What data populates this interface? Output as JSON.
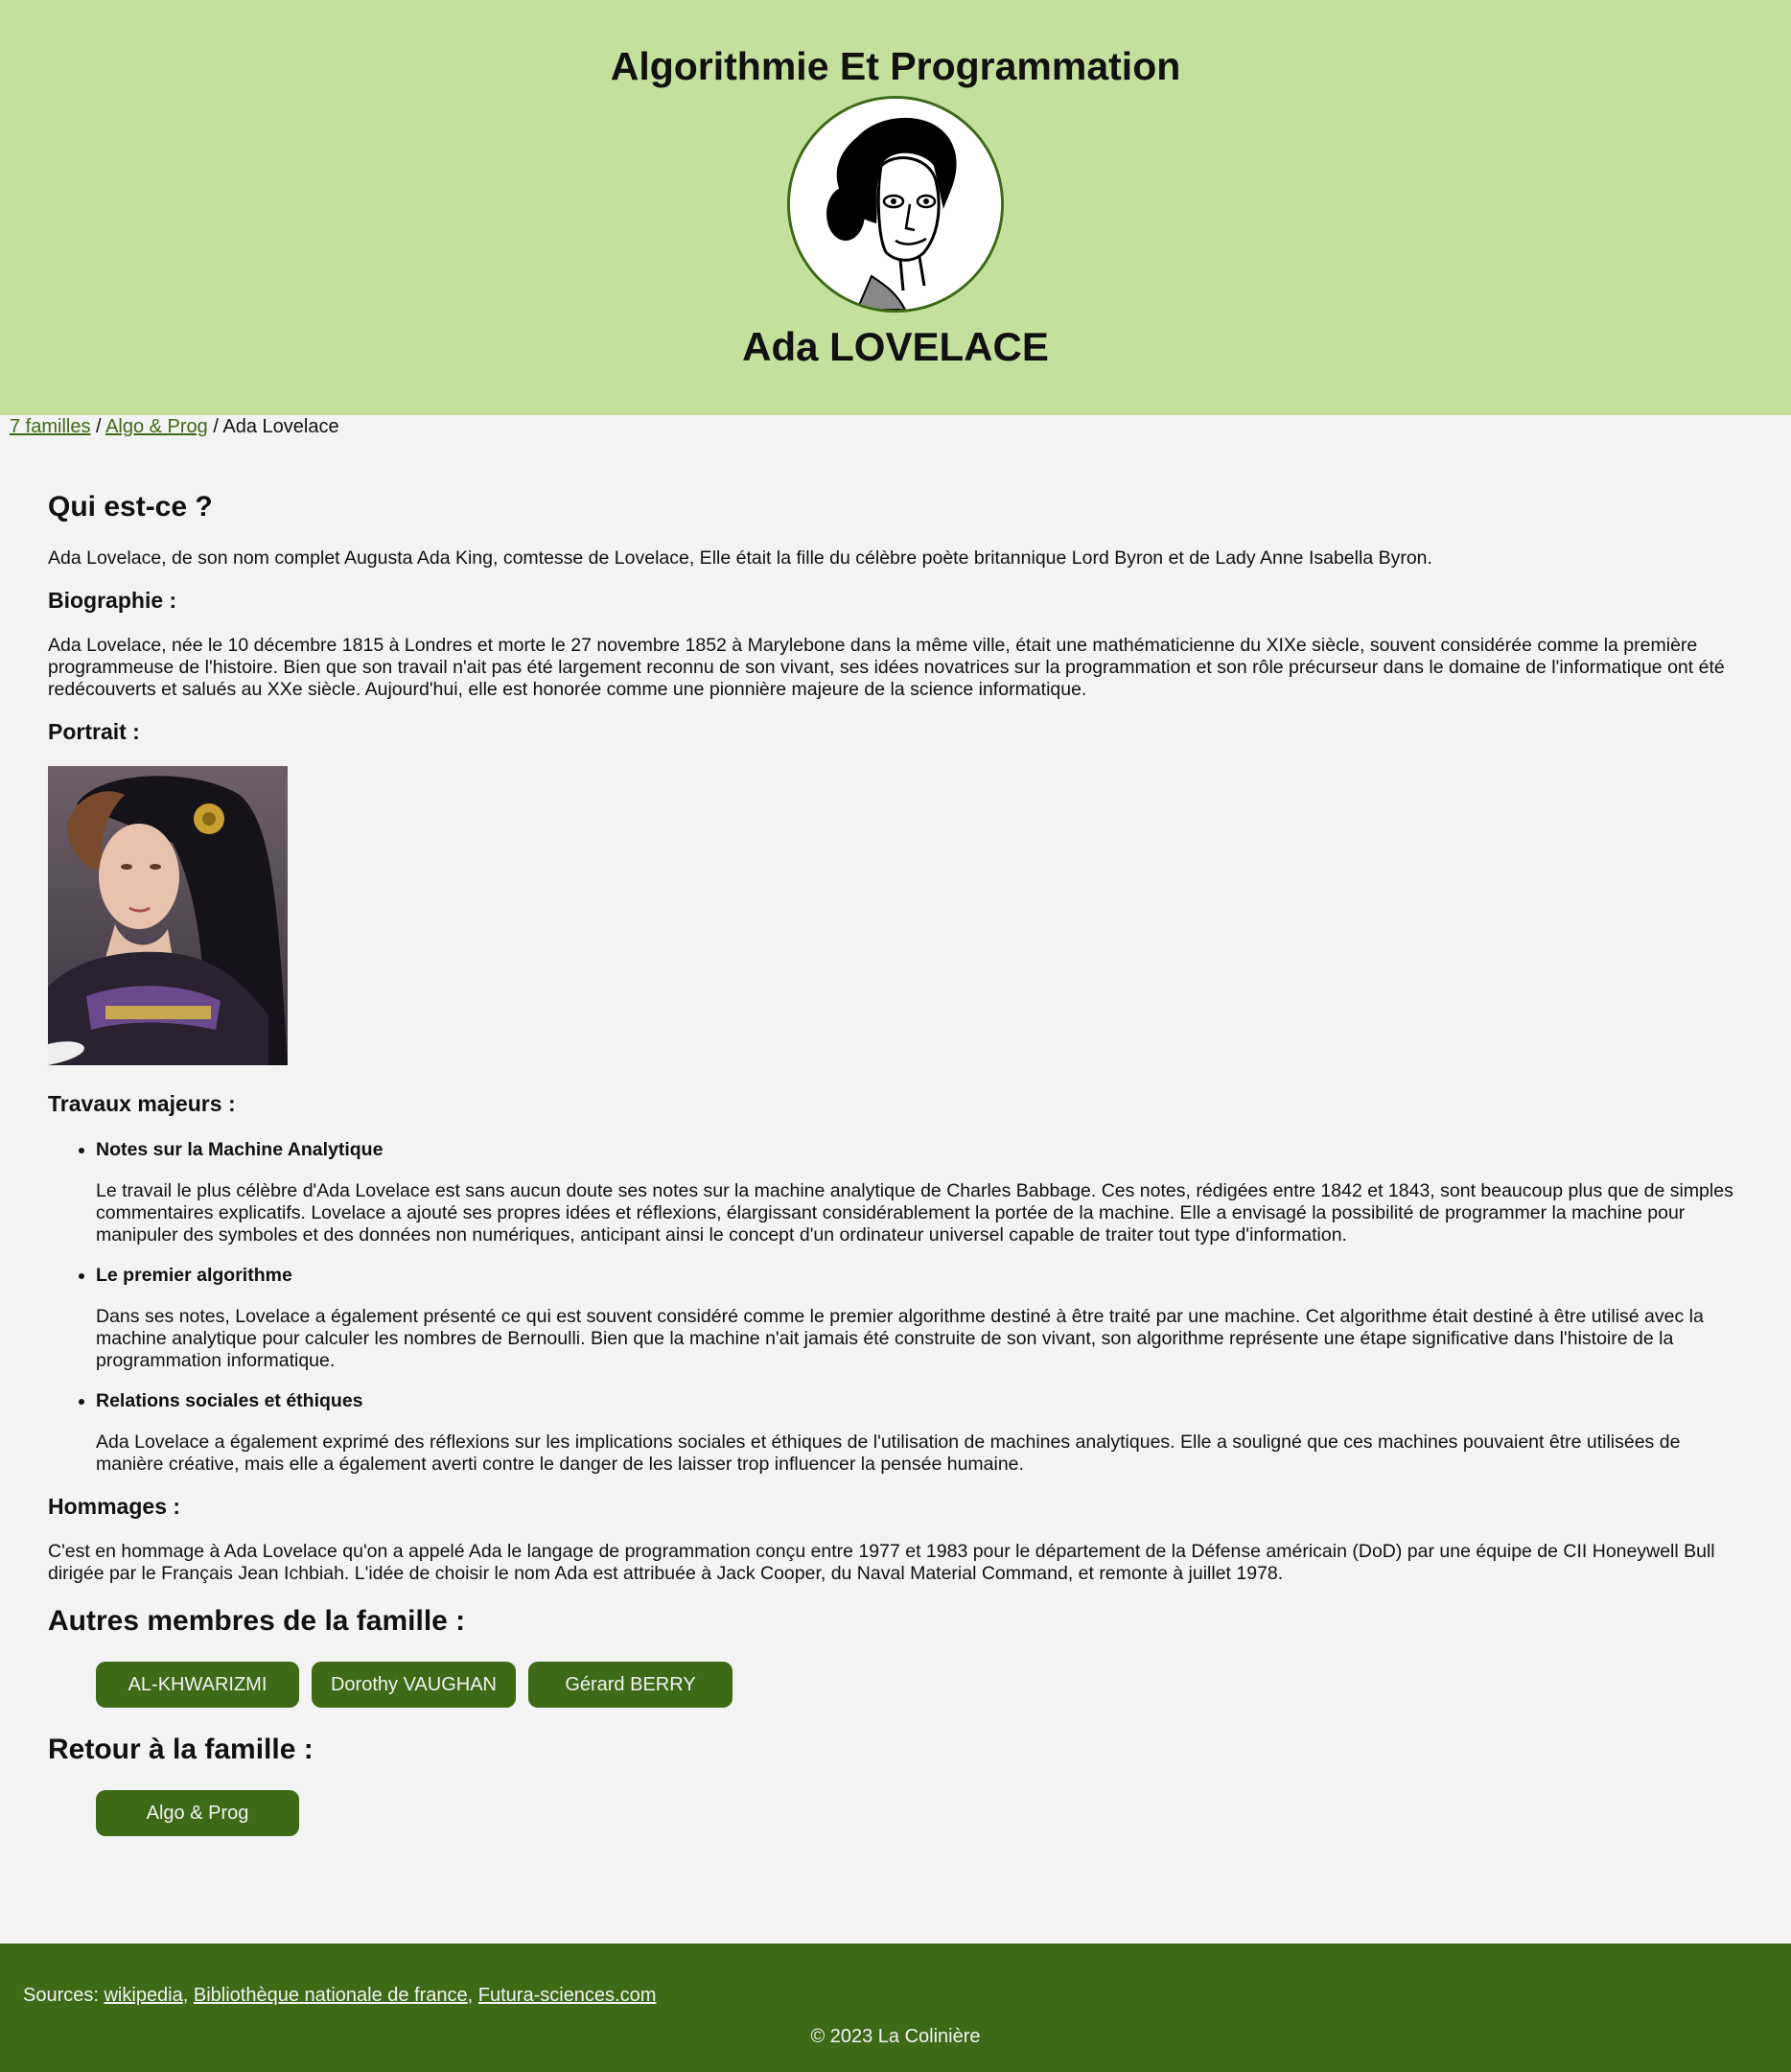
{
  "header": {
    "site_title": "Algorithmie Et Programmation",
    "person_name": "Ada LOVELACE"
  },
  "breadcrumb": {
    "link1": "7 familles",
    "sep1": " / ",
    "link2": "Algo & Prog",
    "sep2": " / ",
    "current": "Ada Lovelace"
  },
  "content": {
    "who_title": "Qui est-ce ?",
    "who_text": "Ada Lovelace, de son nom complet Augusta Ada King, comtesse de Lovelace, Elle était la fille du célèbre poète britannique Lord Byron et de Lady Anne Isabella Byron.",
    "bio_title": "Biographie :",
    "bio_text": "Ada Lovelace, née le 10 décembre 1815 à Londres et morte le 27 novembre 1852 à Marylebone dans la même ville, était une mathématicienne du XIXe siècle, souvent considérée comme la première programmeuse de l'histoire. Bien que son travail n'ait pas été largement reconnu de son vivant, ses idées novatrices sur la programmation et son rôle précurseur dans le domaine de l'informatique ont été redécouverts et salués au XXe siècle. Aujourd'hui, elle est honorée comme une pionnière majeure de la science informatique.",
    "portrait_title": "Portrait :",
    "works_title": "Travaux majeurs :",
    "works": [
      {
        "title": "Notes sur la Machine Analytique",
        "text": "Le travail le plus célèbre d'Ada Lovelace est sans aucun doute ses notes sur la machine analytique de Charles Babbage. Ces notes, rédigées entre 1842 et 1843, sont beaucoup plus que de simples commentaires explicatifs. Lovelace a ajouté ses propres idées et réflexions, élargissant considérablement la portée de la machine. Elle a envisagé la possibilité de programmer la machine pour manipuler des symboles et des données non numériques, anticipant ainsi le concept d'un ordinateur universel capable de traiter tout type d'information."
      },
      {
        "title": "Le premier algorithme",
        "text": "Dans ses notes, Lovelace a également présenté ce qui est souvent considéré comme le premier algorithme destiné à être traité par une machine. Cet algorithme était destiné à être utilisé avec la machine analytique pour calculer les nombres de Bernoulli. Bien que la machine n'ait jamais été construite de son vivant, son algorithme représente une étape significative dans l'histoire de la programmation informatique."
      },
      {
        "title": "Relations sociales et éthiques",
        "text": "Ada Lovelace a également exprimé des réflexions sur les implications sociales et éthiques de l'utilisation de machines analytiques. Elle a souligné que ces machines pouvaient être utilisées de manière créative, mais elle a également averti contre le danger de les laisser trop influencer la pensée humaine."
      }
    ],
    "tribute_title": "Hommages :",
    "tribute_text": "C'est en hommage à Ada Lovelace qu'on a appelé Ada le langage de programmation conçu entre 1977 et 1983 pour le département de la Défense américain (DoD) par une équipe de CII Honeywell Bull dirigée par le Français Jean Ichbiah. L'idée de choisir le nom Ada est attribuée à Jack Cooper, du Naval Material Command, et remonte à juillet 1978.",
    "family_title": "Autres membres de la famille :",
    "family_buttons": [
      "AL-KHWARIZMI",
      "Dorothy VAUGHAN",
      "Gérard BERRY"
    ],
    "back_title": "Retour à la famille :",
    "back_button": "Algo & Prog"
  },
  "footer": {
    "sources_label": "Sources: ",
    "sources": [
      "wikipedia",
      "Bibliothèque nationale de france",
      "Futura-sciences.com"
    ],
    "copyright": "© 2023 La Colinière"
  },
  "colors": {
    "header_bg": "#c5e09d",
    "accent": "#3e6a17",
    "page_bg": "#f3f3f3"
  }
}
